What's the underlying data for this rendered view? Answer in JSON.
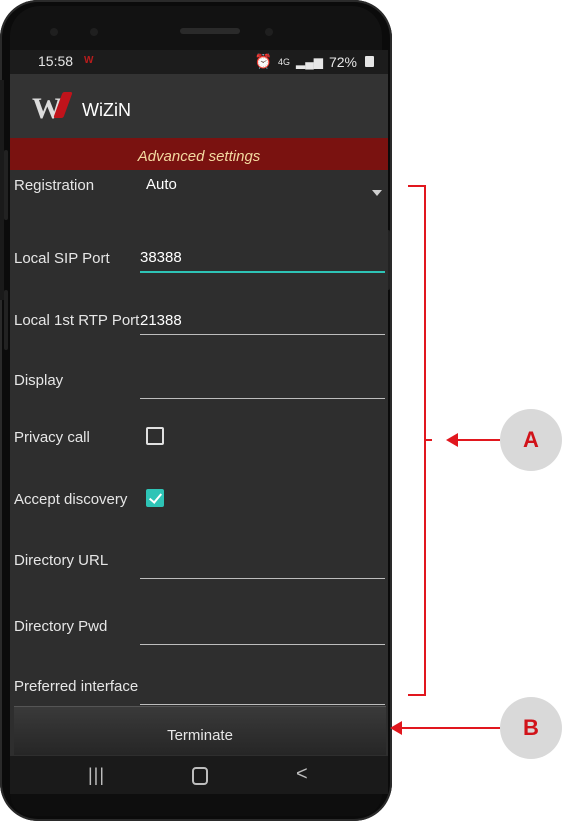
{
  "status_bar": {
    "time": "15:58",
    "app_badge": "W",
    "network": "4G",
    "battery": "72%"
  },
  "app_bar": {
    "logo_letter": "W",
    "title": "WiZiN"
  },
  "section": {
    "title": "Advanced settings"
  },
  "settings": {
    "registration": {
      "label": "Registration",
      "value": "Auto"
    },
    "local_sip_port": {
      "label": "Local SIP Port",
      "value": "38388"
    },
    "local_rtp_port": {
      "label": "Local 1st RTP Port",
      "value": "21388"
    },
    "display": {
      "label": "Display",
      "value": ""
    },
    "privacy_call": {
      "label": "Privacy call",
      "checked": false
    },
    "accept_discovery": {
      "label": "Accept discovery",
      "checked": true
    },
    "directory_url": {
      "label": "Directory URL",
      "value": ""
    },
    "directory_pwd": {
      "label": "Directory Pwd",
      "value": ""
    },
    "preferred_interface": {
      "label": "Preferred interface",
      "value": ""
    }
  },
  "buttons": {
    "terminate": "Terminate"
  },
  "nav": {
    "recents": "|||",
    "back": "<"
  },
  "annotations": {
    "a": "A",
    "b": "B"
  },
  "colors": {
    "accent": "#2ec4b6",
    "header_bg": "#7a1210",
    "annotation_red": "#e1171e"
  }
}
